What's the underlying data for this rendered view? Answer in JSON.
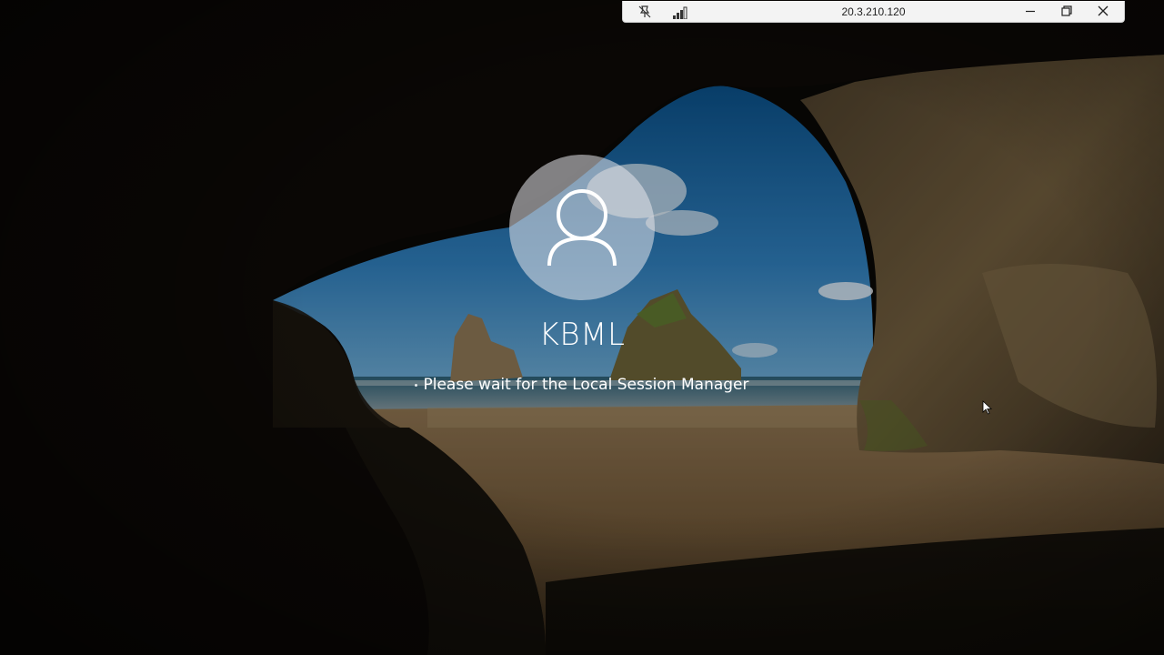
{
  "connection_bar": {
    "host": "20.3.210.120",
    "pin_icon": "pin-off-icon",
    "signal_icon": "connection-quality-icon",
    "minimize_icon": "minimize-icon",
    "restore_icon": "restore-icon",
    "close_icon": "close-icon"
  },
  "login": {
    "username": "KBML",
    "status_message": "Please wait for the Local Session Manager",
    "avatar_icon": "user-icon"
  },
  "colors": {
    "conn_bar_bg": "#f3f3f3",
    "text_on_wallpaper": "#ffffff"
  }
}
